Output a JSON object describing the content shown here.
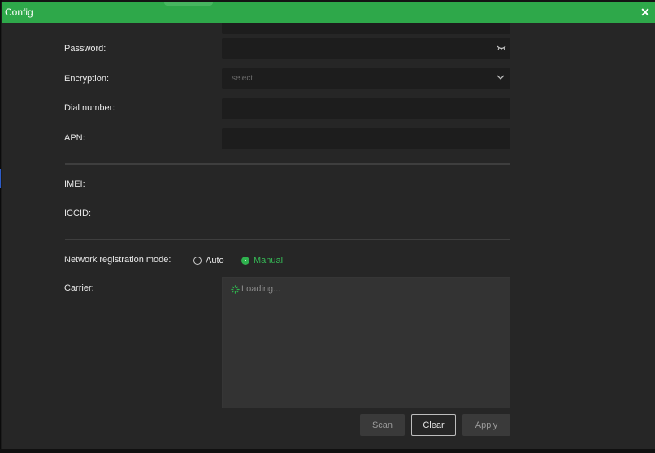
{
  "window": {
    "title": "Config",
    "close_glyph": "✕"
  },
  "form": {
    "password_label": "Password:",
    "encryption_label": "Encryption:",
    "encryption_placeholder": "select",
    "dial_label": "Dial number:",
    "apn_label": "APN:",
    "imei_label": "IMEI:",
    "iccid_label": "ICCID:",
    "network_label": "Network registration mode:",
    "mode_auto": "Auto",
    "mode_manual": "Manual",
    "selected_mode": "Manual",
    "carrier_label": "Carrier:",
    "carrier_loading": "Loading..."
  },
  "buttons": {
    "scan": "Scan",
    "clear": "Clear",
    "apply": "Apply"
  },
  "icons": {
    "close": "close-icon",
    "eye": "eye-hidden-icon",
    "chevron": "chevron-down-icon",
    "spinner": "spinner-icon"
  },
  "colors": {
    "accent": "#2ea84a",
    "background": "#262626",
    "field": "#1d1d1d"
  }
}
